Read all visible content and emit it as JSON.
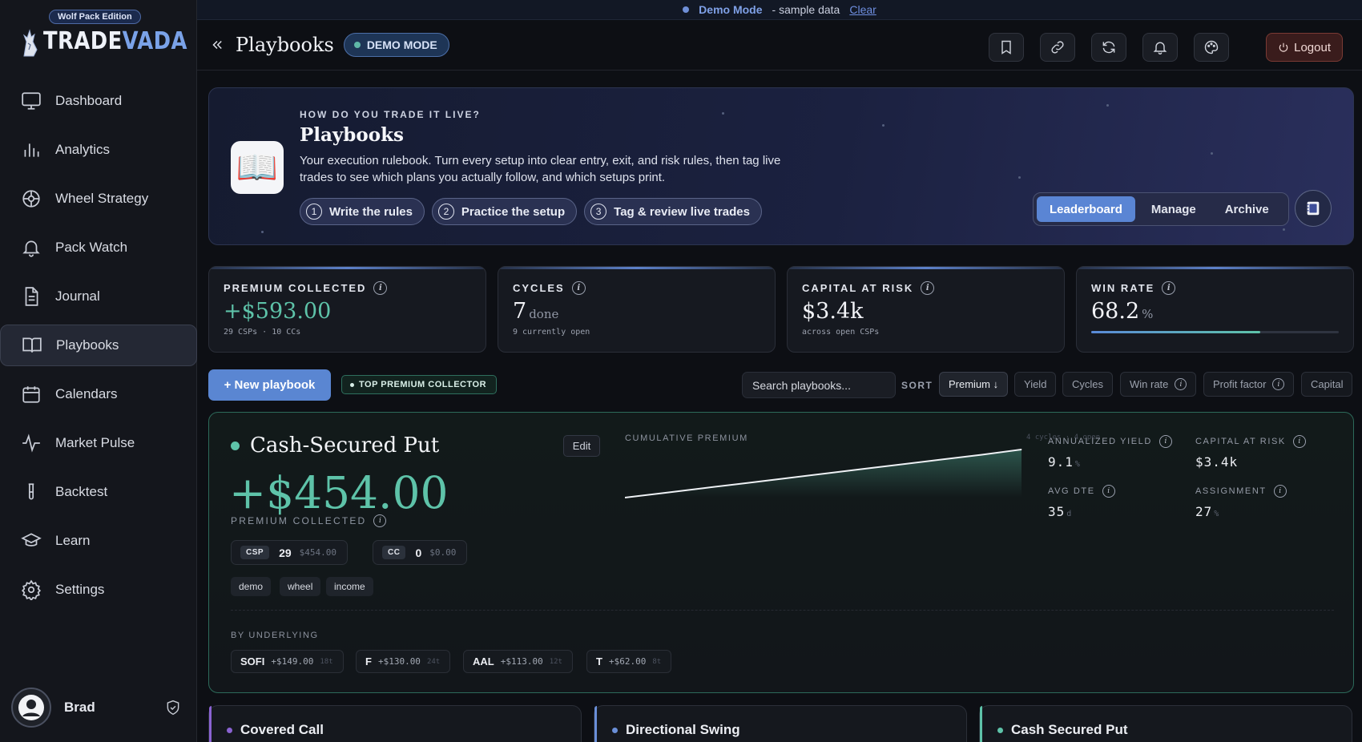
{
  "brand": {
    "edition": "Wolf Pack Edition",
    "name_a": "TRADE",
    "name_b": "VADA"
  },
  "demo_banner": {
    "mode": "Demo Mode",
    "text": "- sample data",
    "clear": "Clear"
  },
  "sidebar": {
    "items": [
      {
        "label": "Dashboard",
        "icon": "monitor-icon"
      },
      {
        "label": "Analytics",
        "icon": "bar-chart-icon"
      },
      {
        "label": "Wheel Strategy",
        "icon": "wheel-icon"
      },
      {
        "label": "Pack Watch",
        "icon": "bell-icon"
      },
      {
        "label": "Journal",
        "icon": "document-icon"
      },
      {
        "label": "Playbooks",
        "icon": "open-book-icon",
        "active": true
      },
      {
        "label": "Calendars",
        "icon": "calendar-icon"
      },
      {
        "label": "Market Pulse",
        "icon": "pulse-icon"
      },
      {
        "label": "Backtest",
        "icon": "test-tube-icon"
      },
      {
        "label": "Learn",
        "icon": "graduation-cap-icon"
      },
      {
        "label": "Settings",
        "icon": "gear-icon"
      }
    ],
    "user": {
      "name": "Brad"
    }
  },
  "header": {
    "title": "Playbooks",
    "demo_pill": "DEMO MODE",
    "logout": "Logout",
    "icons": [
      "bookmark-icon",
      "link-icon",
      "refresh-icon",
      "bell-icon",
      "palette-icon"
    ]
  },
  "hero": {
    "eyebrow": "HOW DO YOU TRADE IT LIVE?",
    "title": "Playbooks",
    "description": "Your execution rulebook. Turn every setup into clear entry, exit, and risk rules, then tag live trades to see which plans you actually follow, and which setups print.",
    "steps": [
      {
        "num": "1",
        "label": "Write the rules"
      },
      {
        "num": "2",
        "label": "Practice the setup"
      },
      {
        "num": "3",
        "label": "Tag & review live trades"
      }
    ],
    "tabs": [
      "Leaderboard",
      "Manage",
      "Archive"
    ],
    "active_tab": "Leaderboard"
  },
  "stats": {
    "premium": {
      "label": "PREMIUM COLLECTED",
      "value": "+$593.00",
      "sub": "29 CSPs · 10 CCs"
    },
    "cycles": {
      "label": "CYCLES",
      "value": "7",
      "unit": "done",
      "sub": "9 currently open"
    },
    "capital": {
      "label": "CAPITAL AT RISK",
      "value": "$3.4k",
      "sub": "across open CSPs"
    },
    "winrate": {
      "label": "WIN RATE",
      "value": "68.2",
      "unit": "%",
      "fill_pct": 68.2
    }
  },
  "toolbar": {
    "new_button": "+ New playbook",
    "badge": "TOP PREMIUM COLLECTOR",
    "search_placeholder": "Search playbooks...",
    "sort_label": "SORT",
    "sort_options": [
      "Premium ↓",
      "Yield",
      "Cycles",
      "Win rate",
      "Profit factor",
      "Capital"
    ]
  },
  "main_card": {
    "title": "Cash-Secured Put",
    "edit": "Edit",
    "big_value": "+$454.00",
    "big_label": "PREMIUM COLLECTED",
    "csp": {
      "tag": "CSP",
      "count": "29",
      "amount": "$454.00"
    },
    "cc": {
      "tag": "CC",
      "count": "0",
      "amount": "$0.00"
    },
    "tags": [
      "demo",
      "wheel",
      "income"
    ],
    "chart_title": "CUMULATIVE PREMIUM",
    "chart_meta": "4 cycles · 4 open",
    "metrics": {
      "yield": {
        "label": "ANNUALIZED YIELD",
        "value": "9.1",
        "unit": "%"
      },
      "capital": {
        "label": "CAPITAL AT RISK",
        "value": "$3.4k",
        "unit": ""
      },
      "dte": {
        "label": "AVG DTE",
        "value": "35",
        "unit": "d"
      },
      "assignment": {
        "label": "ASSIGNMENT",
        "value": "27",
        "unit": "%"
      }
    },
    "by_underlying_label": "BY UNDERLYING",
    "underlyings": [
      {
        "sym": "SOFI",
        "amt": "+$149.00",
        "cnt": "18t"
      },
      {
        "sym": "F",
        "amt": "+$130.00",
        "cnt": "24t"
      },
      {
        "sym": "AAL",
        "amt": "+$113.00",
        "cnt": "12t"
      },
      {
        "sym": "T",
        "amt": "+$62.00",
        "cnt": "8t"
      }
    ]
  },
  "chart_data": {
    "type": "area",
    "title": "CUMULATIVE PREMIUM",
    "x": [
      0,
      1,
      2,
      3,
      4,
      5,
      6,
      7,
      8,
      9,
      10
    ],
    "values": [
      0,
      45,
      90,
      135,
      180,
      225,
      270,
      315,
      360,
      405,
      454
    ]
  },
  "bottom_cards": [
    {
      "title": "Covered Call",
      "color": "#8a63d2"
    },
    {
      "title": "Directional Swing",
      "color": "#6a8fd8"
    },
    {
      "title": "Cash Secured Put",
      "color": "#5ec3a9"
    }
  ]
}
